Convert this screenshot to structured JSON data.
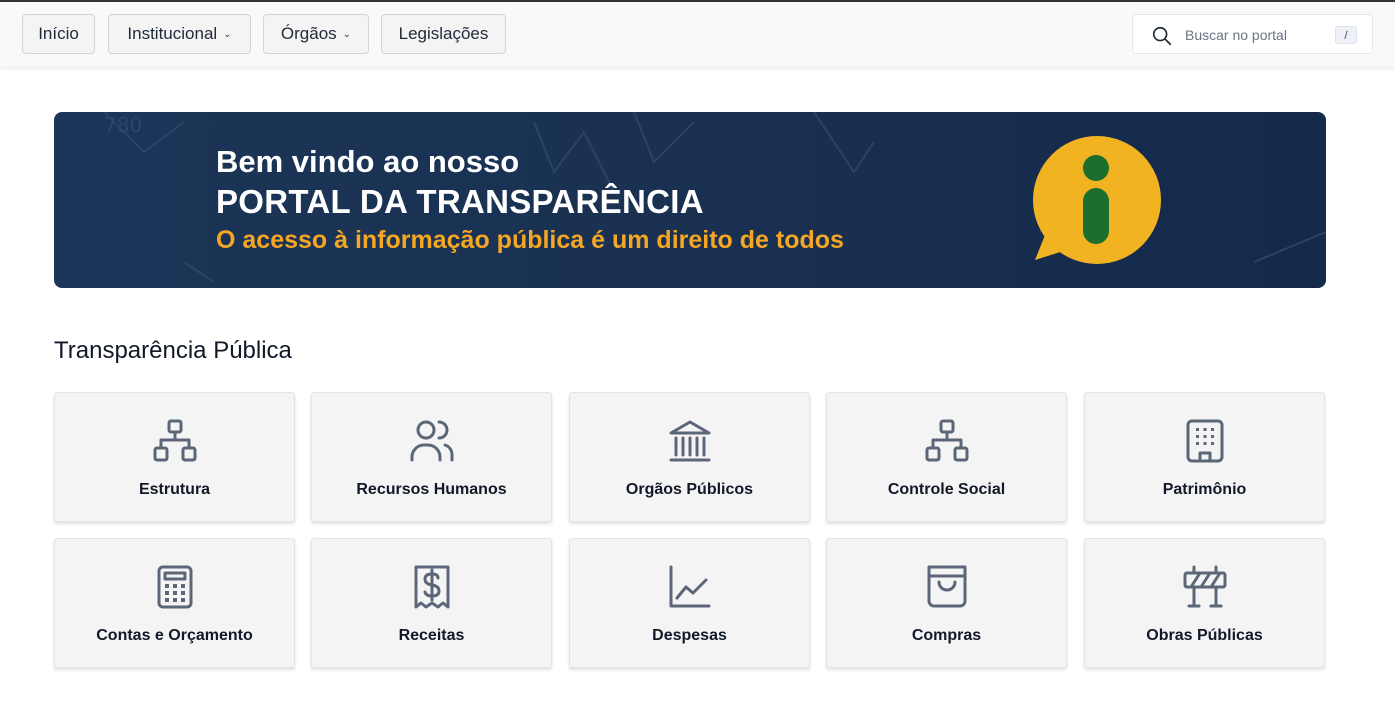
{
  "nav": {
    "items": [
      {
        "label": "Início",
        "has_dropdown": false
      },
      {
        "label": "Institucional",
        "has_dropdown": true
      },
      {
        "label": "Órgãos",
        "has_dropdown": true
      },
      {
        "label": "Legislações",
        "has_dropdown": false
      }
    ],
    "dropdown_icon": "chevron-down-icon"
  },
  "search": {
    "placeholder": "Buscar no portal",
    "shortcut": "/",
    "icon": "search-icon"
  },
  "banner": {
    "line1": "Bem vindo ao nosso",
    "line2": "PORTAL DA TRANSPARÊNCIA",
    "line3": "O acesso à informação pública é um direito de todos",
    "icon": "info-speech-bubble-icon",
    "colors": {
      "background": "#1c3558",
      "accent": "#f5a623",
      "icon_bubble": "#f2b323",
      "icon_mark": "#1b6e2b"
    }
  },
  "section": {
    "title": "Transparência Pública",
    "cards": [
      {
        "label": "Estrutura",
        "icon": "sitemap-icon"
      },
      {
        "label": "Recursos Humanos",
        "icon": "users-icon"
      },
      {
        "label": "Orgãos Públicos",
        "icon": "building-columns-icon"
      },
      {
        "label": "Controle Social",
        "icon": "sitemap-icon"
      },
      {
        "label": "Patrimônio",
        "icon": "office-building-icon"
      },
      {
        "label": "Contas e Orçamento",
        "icon": "calculator-icon"
      },
      {
        "label": "Receitas",
        "icon": "receipt-dollar-icon"
      },
      {
        "label": "Despesas",
        "icon": "chart-line-icon"
      },
      {
        "label": "Compras",
        "icon": "shopping-bag-icon"
      },
      {
        "label": "Obras Públicas",
        "icon": "barrier-icon"
      }
    ]
  },
  "colors": {
    "icon": "#5b6678",
    "card_bg": "#f4f4f5"
  }
}
